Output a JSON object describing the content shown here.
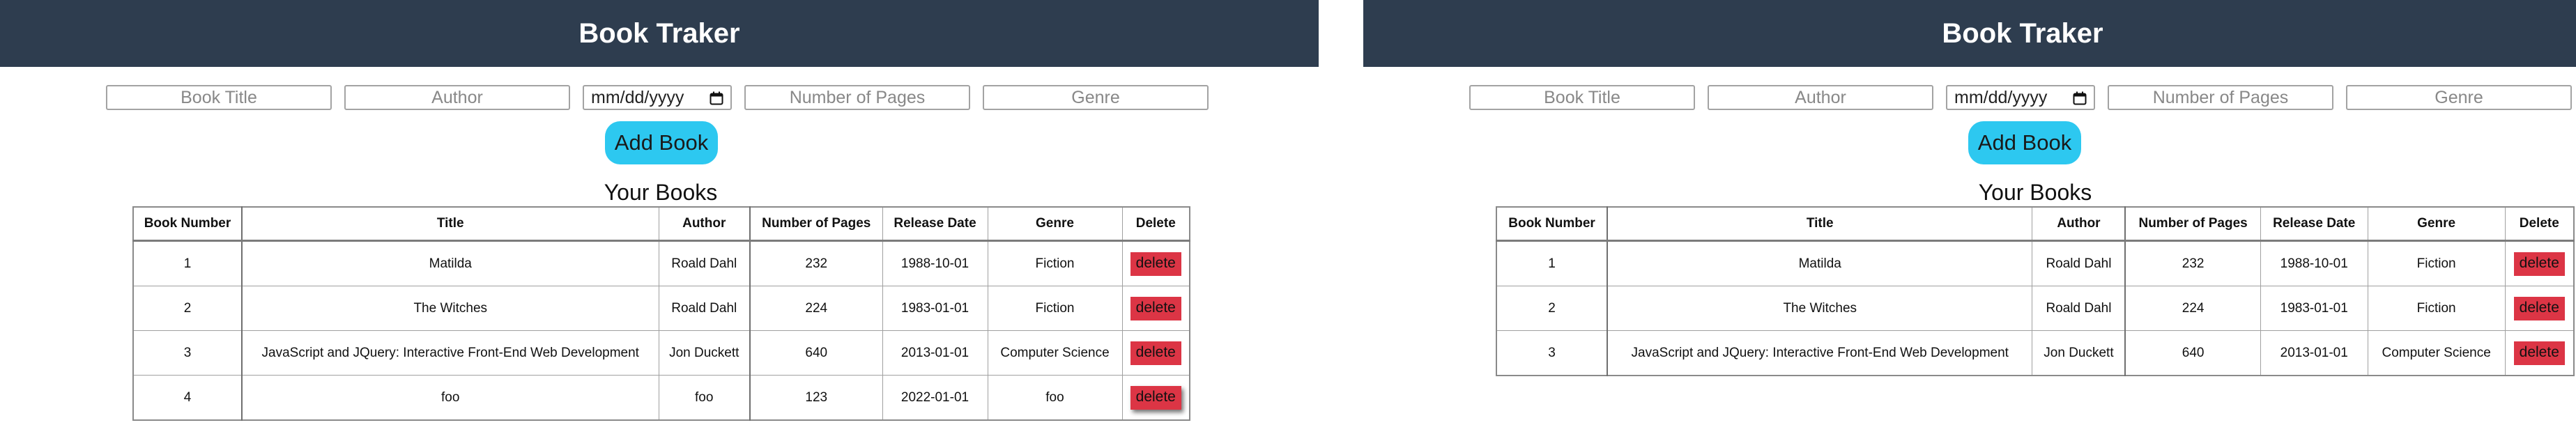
{
  "panels": [
    {
      "header_title": "Book Traker",
      "form": {
        "title_placeholder": "Book Title",
        "author_placeholder": "Author",
        "date_value": "mm/dd/yyyy",
        "pages_placeholder": "Number of Pages",
        "genre_placeholder": "Genre",
        "add_label": "Add Book"
      },
      "section_title": "Your Books",
      "columns": [
        "Book Number",
        "Title",
        "Author",
        "Number of Pages",
        "Release Date",
        "Genre",
        "Delete"
      ],
      "rows": [
        {
          "number": "1",
          "title": "Matilda",
          "author": "Roald Dahl",
          "pages": "232",
          "release": "1988-10-01",
          "genre": "Fiction",
          "delete": "delete"
        },
        {
          "number": "2",
          "title": "The Witches",
          "author": "Roald Dahl",
          "pages": "224",
          "release": "1983-01-01",
          "genre": "Fiction",
          "delete": "delete"
        },
        {
          "number": "3",
          "title": "JavaScript and JQuery: Interactive Front-End Web Development",
          "author": "Jon Duckett",
          "pages": "640",
          "release": "2013-01-01",
          "genre": "Computer Science",
          "delete": "delete"
        },
        {
          "number": "4",
          "title": "foo",
          "author": "foo",
          "pages": "123",
          "release": "2022-01-01",
          "genre": "foo",
          "delete": "delete"
        }
      ]
    },
    {
      "header_title": "Book Traker",
      "form": {
        "title_placeholder": "Book Title",
        "author_placeholder": "Author",
        "date_value": "mm/dd/yyyy",
        "pages_placeholder": "Number of Pages",
        "genre_placeholder": "Genre",
        "add_label": "Add Book"
      },
      "section_title": "Your Books",
      "columns": [
        "Book Number",
        "Title",
        "Author",
        "Number of Pages",
        "Release Date",
        "Genre",
        "Delete"
      ],
      "rows": [
        {
          "number": "1",
          "title": "Matilda",
          "author": "Roald Dahl",
          "pages": "232",
          "release": "1988-10-01",
          "genre": "Fiction",
          "delete": "delete"
        },
        {
          "number": "2",
          "title": "The Witches",
          "author": "Roald Dahl",
          "pages": "224",
          "release": "1983-01-01",
          "genre": "Fiction",
          "delete": "delete"
        },
        {
          "number": "3",
          "title": "JavaScript and JQuery: Interactive Front-End Web Development",
          "author": "Jon Duckett",
          "pages": "640",
          "release": "2013-01-01",
          "genre": "Computer Science",
          "delete": "delete"
        }
      ]
    }
  ],
  "colors": {
    "header_bg": "#2e3d4f",
    "add_button": "#2dc8f0",
    "delete_button": "#dc3545"
  },
  "icons": {
    "date_picker": "calendar-icon"
  }
}
